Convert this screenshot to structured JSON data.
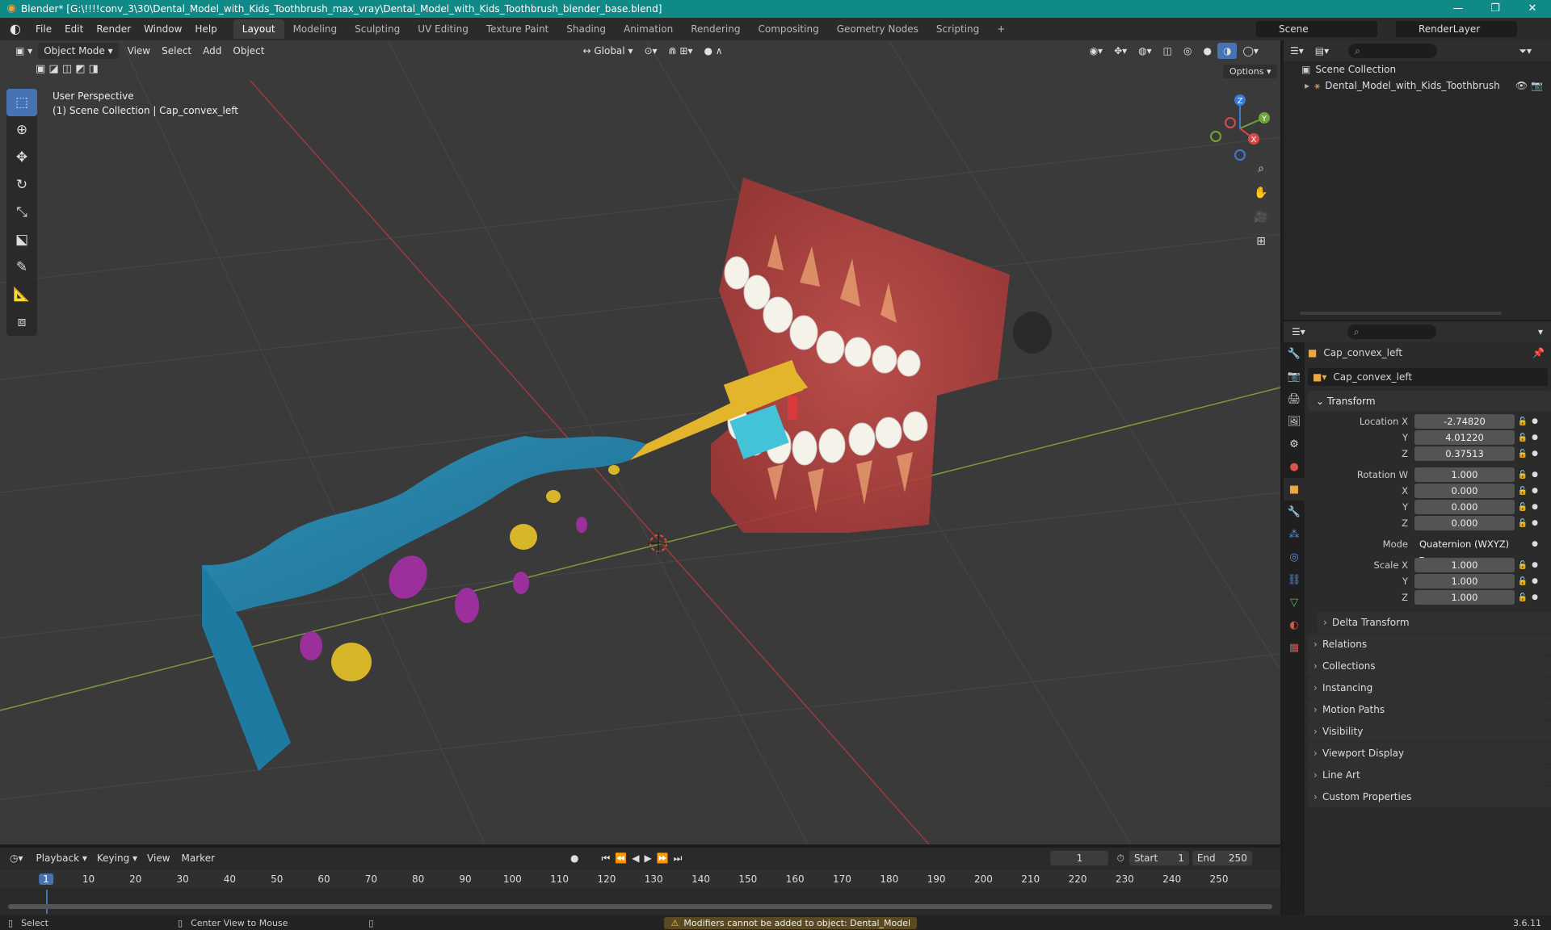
{
  "window": {
    "title": "Blender* [G:\\!!!!conv_3\\30\\Dental_Model_with_Kids_Toothbrush_max_vray\\Dental_Model_with_Kids_Toothbrush_blender_base.blend]",
    "minimize": "—",
    "maximize": "❐",
    "close": "✕"
  },
  "menu": [
    "File",
    "Edit",
    "Render",
    "Window",
    "Help"
  ],
  "workspaces": [
    "Layout",
    "Modeling",
    "Sculpting",
    "UV Editing",
    "Texture Paint",
    "Shading",
    "Animation",
    "Rendering",
    "Compositing",
    "Geometry Nodes",
    "Scripting",
    "+"
  ],
  "scene": {
    "name": "Scene",
    "render_layer": "RenderLayer"
  },
  "viewport": {
    "mode": "Object Mode",
    "menus": [
      "View",
      "Select",
      "Add",
      "Object"
    ],
    "orientation": "Global",
    "options": "Options",
    "perspective": "User Perspective",
    "collection_path": "(1) Scene Collection | Cap_convex_left",
    "gizmo": {
      "z": "Z",
      "y": "Y",
      "x": "X"
    }
  },
  "outliner": {
    "root": "Scene Collection",
    "items": [
      "Dental_Model_with_Kids_Toothbrush"
    ]
  },
  "properties": {
    "object_name": "Cap_convex_left",
    "datablock": "Cap_convex_left",
    "transform_title": "Transform",
    "location": {
      "label": "Location X",
      "x": "-2.74820",
      "y": "4.01220",
      "z": "0.37513"
    },
    "rotation": {
      "label": "Rotation W",
      "w": "1.000",
      "x": "0.000",
      "y": "0.000",
      "z": "0.000"
    },
    "mode_label": "Mode",
    "mode_value": "Quaternion (WXYZ)",
    "scale": {
      "label": "Scale X",
      "x": "1.000",
      "y": "1.000",
      "z": "1.000"
    },
    "axis_labels": {
      "y": "Y",
      "z": "Z",
      "x": "X"
    },
    "delta": "Delta Transform",
    "panels": [
      "Relations",
      "Collections",
      "Instancing",
      "Motion Paths",
      "Visibility",
      "Viewport Display",
      "Line Art",
      "Custom Properties"
    ]
  },
  "timeline": {
    "menus": [
      "Playback",
      "Keying",
      "View",
      "Marker"
    ],
    "current_frame": "1",
    "start_label": "Start",
    "start": "1",
    "end_label": "End",
    "end": "250",
    "ticks": [
      "1",
      "10",
      "20",
      "30",
      "40",
      "50",
      "60",
      "70",
      "80",
      "90",
      "100",
      "110",
      "120",
      "130",
      "140",
      "150",
      "160",
      "170",
      "180",
      "190",
      "200",
      "210",
      "220",
      "230",
      "240",
      "250"
    ]
  },
  "status": {
    "select": "Select",
    "center": "Center View to Mouse",
    "warning": "Modifiers cannot be added to object: Dental_Model",
    "version": "3.6.11"
  }
}
